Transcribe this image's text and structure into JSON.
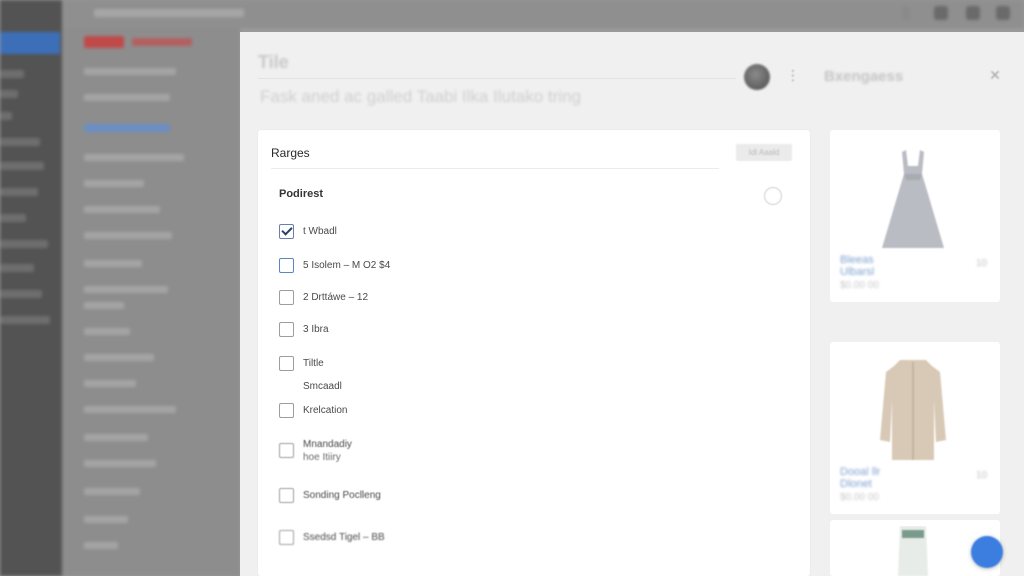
{
  "modal": {
    "title": "Tile",
    "subtitle": "Fask aned ac galled Taabi Ilka Ilutako tring",
    "right_title": "Bxengaess",
    "more_icon": "more-icon",
    "close_icon": "close-icon"
  },
  "filters": {
    "title": "Rarges",
    "action_label": "Idl Aaald",
    "section_title": "Podirest",
    "options": [
      {
        "label": "t Wbadl",
        "checked": true
      },
      {
        "label": "5 Isolem – M O2 $4",
        "checked": false
      },
      {
        "label": "2 Drttáwe – 12",
        "checked": false
      },
      {
        "label": "3 Ibra",
        "checked": false
      },
      {
        "label": "Tiltle",
        "checked": false
      },
      {
        "label": "Smcaadl",
        "checked": false
      },
      {
        "label": "Krelcation",
        "checked": false
      },
      {
        "label": "Mnandadiy",
        "sub": "hoe Itiiry",
        "checked": false
      },
      {
        "label": "Sonding Poclleng",
        "checked": false
      },
      {
        "label": "Ssedsd Tigel – BB",
        "checked": false
      }
    ]
  },
  "products": [
    {
      "name": "Bleeas",
      "sub": "Ulbarsl",
      "price": "$0.00 00",
      "qty": "10",
      "image": "dress-image"
    },
    {
      "name": "Dooal llr",
      "sub": "Dlonet",
      "price": "$0.00 00",
      "qty": "10",
      "image": "coat-image"
    }
  ],
  "colors": {
    "accent": "#3b7ee0",
    "checkbox_blue": "#5b84c4",
    "link": "#7fa0d0"
  }
}
